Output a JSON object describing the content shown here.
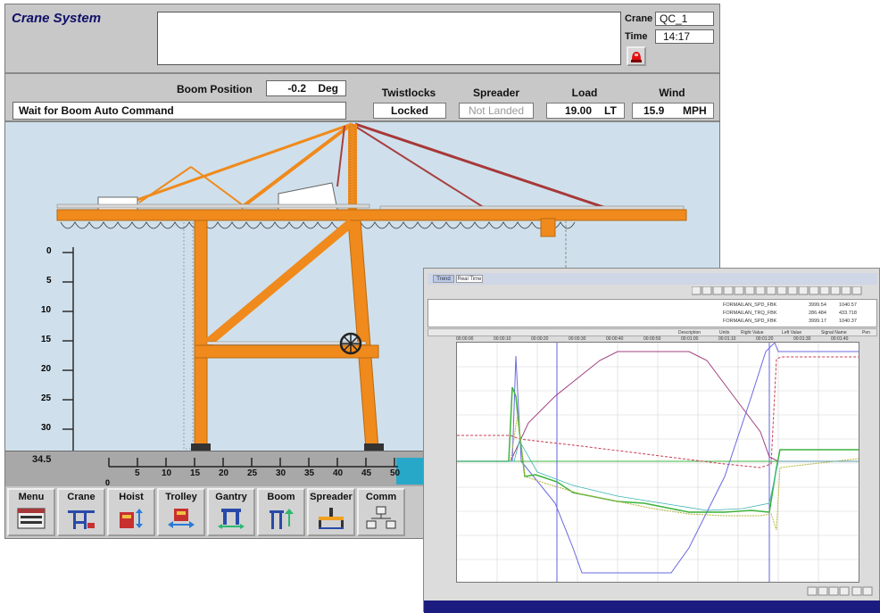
{
  "colors": {
    "crane_orange": "#f08a1c",
    "sky": "#cfe0ec",
    "panel_gray": "#c8c8c8",
    "water": "#28a8c8",
    "trend_blue": "#3c3cdc",
    "trend_red": "#c83c50",
    "trend_green": "#3cb43c",
    "trend_yellow": "#b4b43c"
  },
  "header": {
    "app_title": "Crane System",
    "crane_label": "Crane",
    "crane_value": "QC_1",
    "time_label": "Time",
    "time_value": "14:17",
    "alarm_icon": "alarm-light-icon"
  },
  "status": {
    "boom_position_label": "Boom Position",
    "boom_position_value": "-0.2",
    "boom_position_unit": "Deg",
    "command_message": "Wait for Boom Auto Command",
    "twistlocks_label": "Twistlocks",
    "twistlocks_value": "Locked",
    "spreader_label": "Spreader",
    "spreader_value": "Not Landed",
    "load_label": "Load",
    "load_value": "19.00",
    "load_unit": "LT",
    "wind_label": "Wind",
    "wind_value": "15.9",
    "wind_unit": "MPH"
  },
  "scale": {
    "height_ticks": [
      "0",
      "5",
      "10",
      "15",
      "20",
      "25",
      "30"
    ],
    "depth_value": "34.5",
    "x_start": "0",
    "x_ticks": [
      "5",
      "10",
      "15",
      "20",
      "25",
      "30",
      "35",
      "40",
      "45",
      "50"
    ]
  },
  "nav": [
    {
      "label": "Menu",
      "icon": "menu-panel-icon"
    },
    {
      "label": "Crane",
      "icon": "crane-icon"
    },
    {
      "label": "Hoist",
      "icon": "hoist-icon"
    },
    {
      "label": "Trolley",
      "icon": "trolley-icon"
    },
    {
      "label": "Gantry",
      "icon": "gantry-icon"
    },
    {
      "label": "Boom",
      "icon": "boom-icon"
    },
    {
      "label": "Spreader",
      "icon": "spreader-icon"
    },
    {
      "label": "Comm",
      "icon": "network-icon"
    }
  ],
  "trend": {
    "tab_1": "Trend",
    "tab_2": "Real Time",
    "legend_rows": [
      {
        "signal": "FORMAILAN_SPD_FBK",
        "left": "3999.54",
        "right": "1040.57"
      },
      {
        "signal": "FORMAILAN_TRQ_FBK",
        "left": "286.484",
        "right": "433.718"
      },
      {
        "signal": "FORMAILAN_SPD_FBK",
        "left": "3999.17",
        "right": "1040.37"
      }
    ],
    "column_headers": [
      "Pen",
      "Signal Name",
      "Left Value",
      "Right Value",
      "Units",
      "Description"
    ],
    "time_labels": [
      "00:00:00",
      "00:00:10",
      "00:00:20",
      "00:00:30",
      "00:00:40",
      "00:00:50",
      "00:01:00",
      "00:01:10",
      "00:01:20",
      "00:01:30",
      "00:01:40"
    ]
  }
}
